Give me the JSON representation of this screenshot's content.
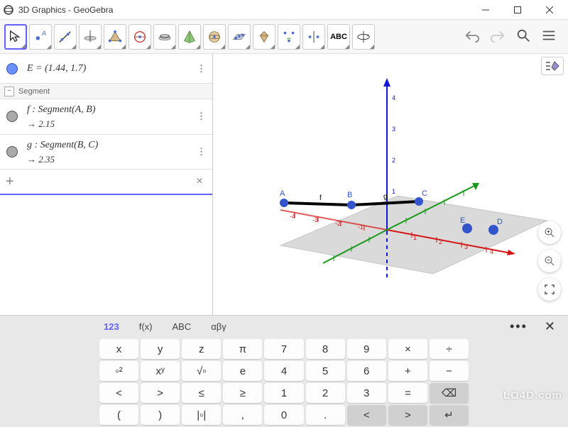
{
  "window": {
    "title": "3D Graphics - GeoGebra"
  },
  "toolbar_right": {
    "undo": "undo",
    "redo": "redo",
    "search": "search",
    "menu": "menu"
  },
  "algebra": {
    "point_row": {
      "label": "E = (1.44, 1.7)"
    },
    "section": "Segment",
    "seg1": {
      "def": "f : Segment(A, B)",
      "val": "→   2.15"
    },
    "seg2": {
      "def": "g : Segment(B, C)",
      "val": "→   2.35"
    },
    "input_placeholder": ""
  },
  "graphics": {
    "points": {
      "A": "A",
      "B": "B",
      "C": "C",
      "D": "D",
      "E": "E"
    },
    "seg_labels": {
      "f": "f",
      "g": "g"
    },
    "axis_ticks": [
      "-4",
      "-3",
      "-2",
      "-1",
      "1",
      "2",
      "3",
      "4"
    ]
  },
  "keyboard": {
    "tabs": {
      "t1": "123",
      "t2": "f(x)",
      "t3": "ABC",
      "t4": "αβγ"
    },
    "keys": {
      "r1": [
        "x",
        "y",
        "z",
        "π",
        "7",
        "8",
        "9",
        "×",
        "÷"
      ],
      "r2": [
        "▫²",
        "xʸ",
        "√▫",
        "e",
        "4",
        "5",
        "6",
        "+",
        "−"
      ],
      "r3": [
        "<",
        ">",
        "≤",
        "≥",
        "1",
        "2",
        "3",
        "=",
        "⌫"
      ],
      "r4": [
        "(",
        ")",
        "|▫|",
        ",",
        "0",
        ".",
        "<",
        ">",
        "↵"
      ]
    }
  },
  "watermark": "LO4D.com"
}
